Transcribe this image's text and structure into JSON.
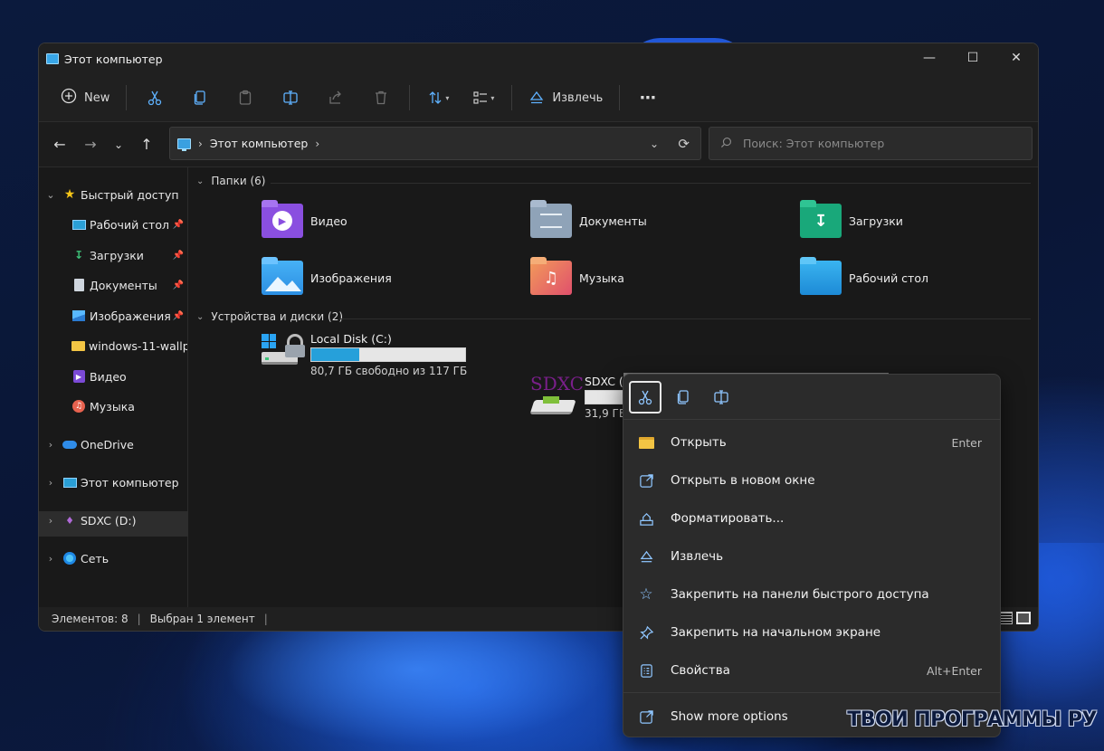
{
  "window": {
    "title": "Этот компьютер"
  },
  "toolbar": {
    "new_label": "New",
    "eject_label": "Извлечь"
  },
  "address": {
    "crumb": "Этот компьютер"
  },
  "search": {
    "placeholder": "Поиск: Этот компьютер"
  },
  "sidebar": {
    "quick_access": "Быстрый доступ",
    "items": [
      {
        "label": "Рабочий стол"
      },
      {
        "label": "Загрузки"
      },
      {
        "label": "Документы"
      },
      {
        "label": "Изображения"
      },
      {
        "label": "windows-11-wallpa"
      },
      {
        "label": "Видео"
      },
      {
        "label": "Музыка"
      }
    ],
    "onedrive": "OneDrive",
    "this_pc": "Этот компьютер",
    "sdxc": "SDXC (D:)",
    "network": "Сеть"
  },
  "content": {
    "folders_header": "Папки (6)",
    "folders": [
      {
        "name": "Видео"
      },
      {
        "name": "Документы"
      },
      {
        "name": "Загрузки"
      },
      {
        "name": "Изображения"
      },
      {
        "name": "Музыка"
      },
      {
        "name": "Рабочий стол"
      }
    ],
    "devices_header": "Устройства и диски (2)",
    "drives": [
      {
        "name": "Local Disk (C:)",
        "free": "80,7 ГБ свободно из 117 ГБ",
        "used_fraction": 0.31
      },
      {
        "name": "SDXC (D:)",
        "free": "31,9 ГБ свободно из 31,9 ГБ",
        "used_fraction": 0.0
      }
    ],
    "sdxc_logo": "SDXC"
  },
  "status": {
    "count": "Элементов: 8",
    "selected": "Выбран 1 элемент"
  },
  "context_menu": {
    "items": [
      {
        "label": "Открыть",
        "shortcut": "Enter"
      },
      {
        "label": "Открыть в новом окне",
        "shortcut": ""
      },
      {
        "label": "Форматировать...",
        "shortcut": ""
      },
      {
        "label": "Извлечь",
        "shortcut": ""
      },
      {
        "label": "Закрепить на панели быстрого доступа",
        "shortcut": ""
      },
      {
        "label": "Закрепить на начальном экране",
        "shortcut": ""
      },
      {
        "label": "Свойства",
        "shortcut": "Alt+Enter"
      }
    ],
    "more": "Show more options"
  },
  "watermark": "ТВОИ ПРОГРАММЫ РУ"
}
